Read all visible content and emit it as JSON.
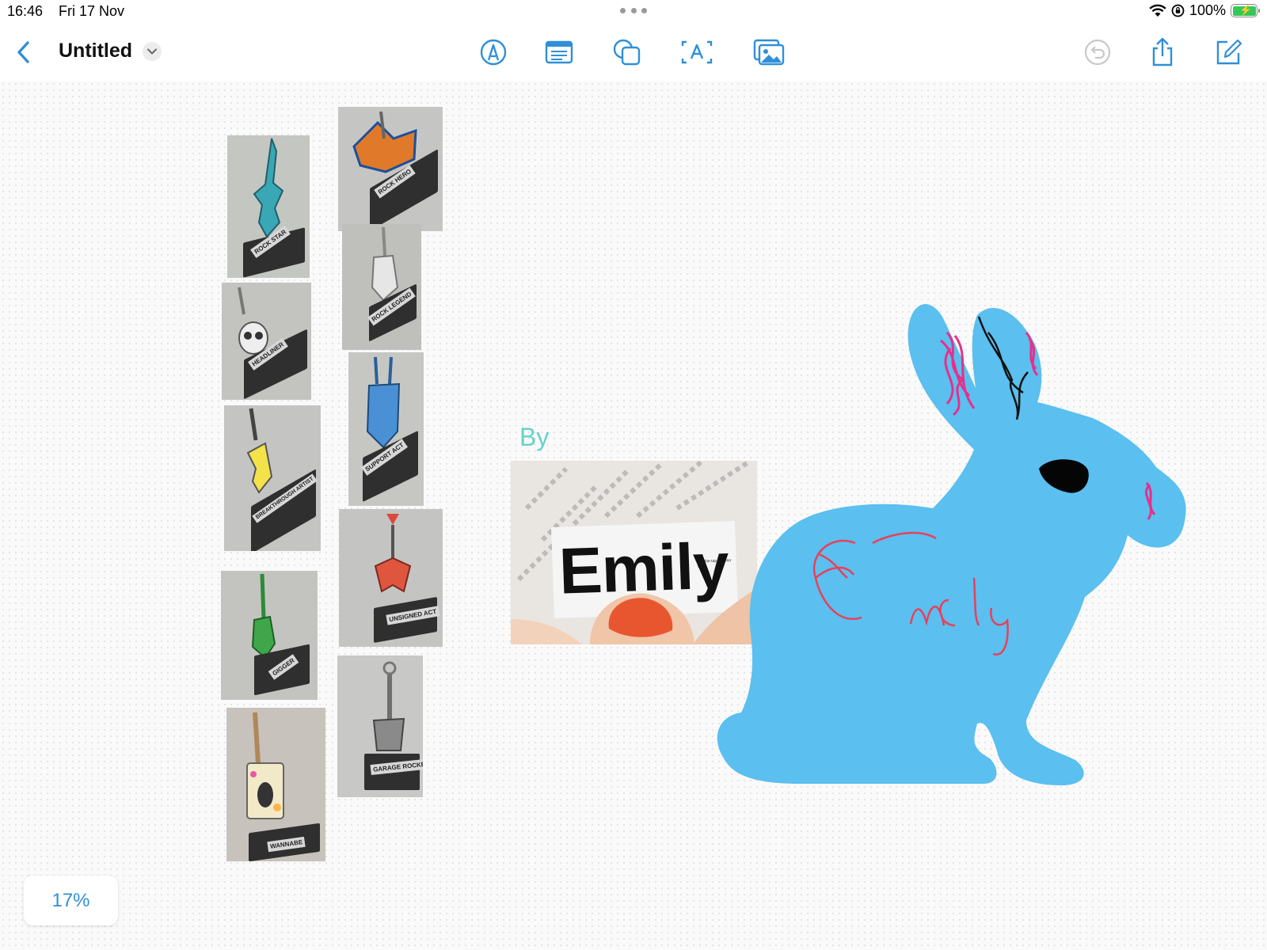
{
  "status_bar": {
    "time": "16:46",
    "date": "Fri 17 Nov",
    "battery_percent": "100%",
    "battery_level": 1.0,
    "battery_charging": true
  },
  "toolbar": {
    "title": "Untitled",
    "back_icon": "chevron-left-icon",
    "title_menu_icon": "chevron-down-icon",
    "tools": [
      "pen-icon",
      "text-box-icon",
      "shapes-icon",
      "text-icon",
      "media-icon"
    ],
    "right_actions": [
      "undo-icon",
      "share-icon",
      "new-board-icon"
    ],
    "accent_color": "#2f8fd8"
  },
  "board": {
    "by_text": "By",
    "name_photo_text": "Emily",
    "name_photo_small_text": "Double-tap to enter text",
    "handwriting": "Emily",
    "bunny_color": "#5bbfef",
    "trophy_labels": [
      "ROCK STAR",
      "HEADLINER",
      "BREAKTHROUGH ARTIST",
      "GIGGER",
      "WANNABE",
      "ROCK HERO",
      "ROCK LEGEND",
      "SUPPORT ACT",
      "UNSIGNED ACT",
      "GARAGE ROCKER"
    ]
  },
  "zoom": {
    "label": "17%"
  }
}
